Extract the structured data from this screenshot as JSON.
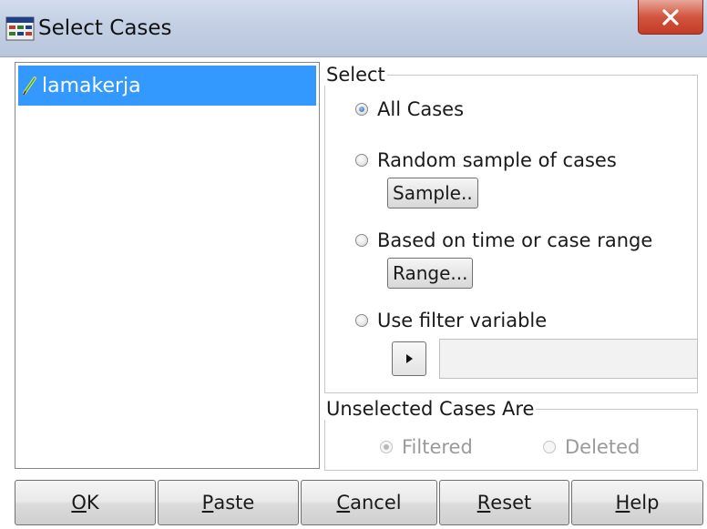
{
  "window": {
    "title": "Select Cases"
  },
  "variables": [
    {
      "name": "lamakerja",
      "icon": "scale-pencil-icon",
      "selected": true
    }
  ],
  "select_group": {
    "legend": "Select",
    "options": [
      {
        "label": "All Cases",
        "checked": true
      },
      {
        "label": "Random sample of cases",
        "checked": false,
        "button": "Sample.."
      },
      {
        "label": "Based on time or case range",
        "checked": false,
        "button": "Range..."
      },
      {
        "label": "Use filter variable",
        "checked": false
      }
    ],
    "filter_value": ""
  },
  "unselected_group": {
    "legend": "Unselected Cases Are",
    "options": [
      {
        "label": "Filtered",
        "checked": true,
        "enabled": false
      },
      {
        "label": "Deleted",
        "checked": false,
        "enabled": false
      }
    ]
  },
  "buttons": {
    "ok": {
      "mnemonic": "O",
      "rest": "K"
    },
    "paste": {
      "mnemonic": "P",
      "rest": "aste"
    },
    "cancel": {
      "mnemonic": "C",
      "rest": "ancel"
    },
    "reset": {
      "mnemonic": "R",
      "rest": "eset"
    },
    "help": {
      "mnemonic": "H",
      "rest": "elp"
    }
  },
  "colors": {
    "selection": "#3399ff",
    "close_button": "#c94a34",
    "titlebar": "#c3cfe3"
  }
}
